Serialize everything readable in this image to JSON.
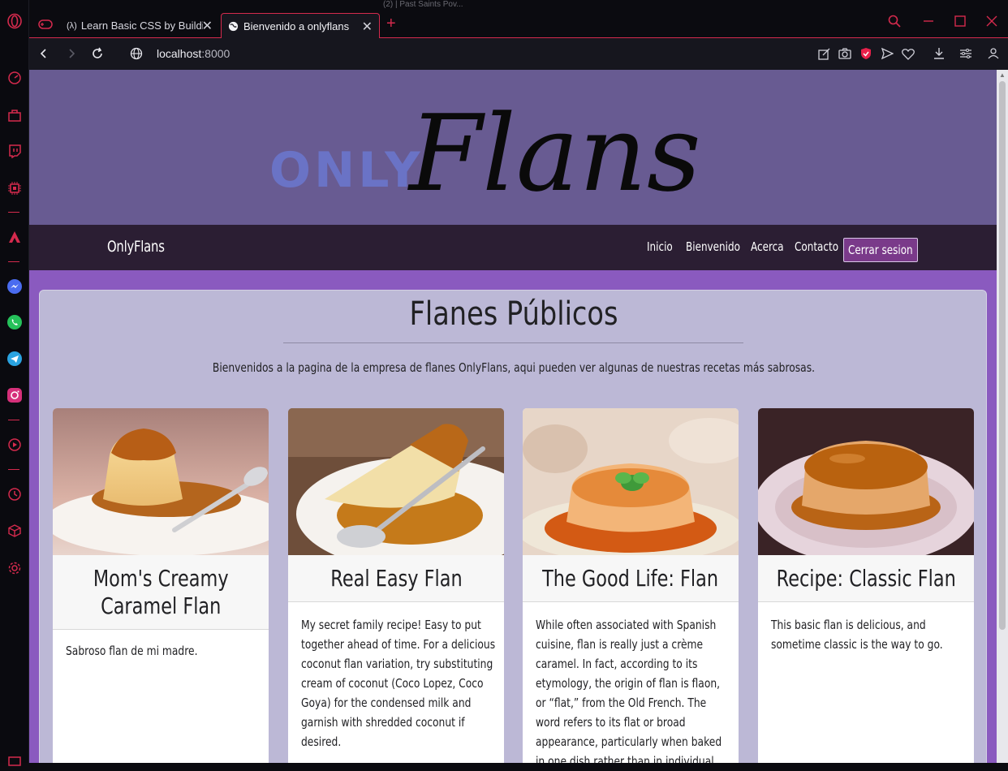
{
  "browser": {
    "tabs": [
      {
        "title": "Learn Basic CSS by Building",
        "active": false
      },
      {
        "title": "Bienvenido a onlyflans",
        "active": true
      }
    ],
    "peek_title": "(2) | Past Saints Pov...",
    "url_host": "localhost",
    "url_port": ":8000"
  },
  "site": {
    "logo_small": "ONLY",
    "logo_script": "Flans",
    "brand": "OnlyFlans",
    "nav": [
      "Inicio",
      "Bienvenido",
      "Acerca",
      "Contacto"
    ],
    "logout_label": "Cerrar sesion"
  },
  "main": {
    "title": "Flanes Públicos",
    "intro": "Bienvenidos a la pagina de la empresa de flanes OnlyFlans, aqui pueden ver algunas de nuestras recetas más sabrosas.",
    "cards": [
      {
        "title_line1": "Mom's Creamy",
        "title_line2": "Caramel Flan",
        "body": "Sabroso flan de mi madre."
      },
      {
        "title_line1": "Real Easy Flan",
        "title_line2": "",
        "body": "My secret family recipe! Easy to put together ahead of time. For a delicious coconut flan variation, try substituting cream of coconut (Coco Lopez, Coco Goya) for the condensed milk and garnish with shredded coconut if desired."
      },
      {
        "title_line1": "The Good Life: Flan",
        "title_line2": "",
        "body": "While often associated with Spanish cuisine, flan is really just a crème caramel. In fact, according to its etymology, the origin of flan is flaon, or “flat,” from the Old French. The word refers to its flat or broad appearance, particularly when baked in one dish rather than in individual ramekins. In"
      },
      {
        "title_line1": "Recipe: Classic Flan",
        "title_line2": "",
        "body": "This basic flan is delicious, and sometime classic is the way to go."
      }
    ]
  },
  "colors": {
    "opera_red": "#d42a4d",
    "hero_bg": "#685b92",
    "nav_bg": "#2b1e33",
    "page_bg": "#8a5abf",
    "panel_bg": "#bcb8d6",
    "logout_bg": "#7a3a8a"
  }
}
